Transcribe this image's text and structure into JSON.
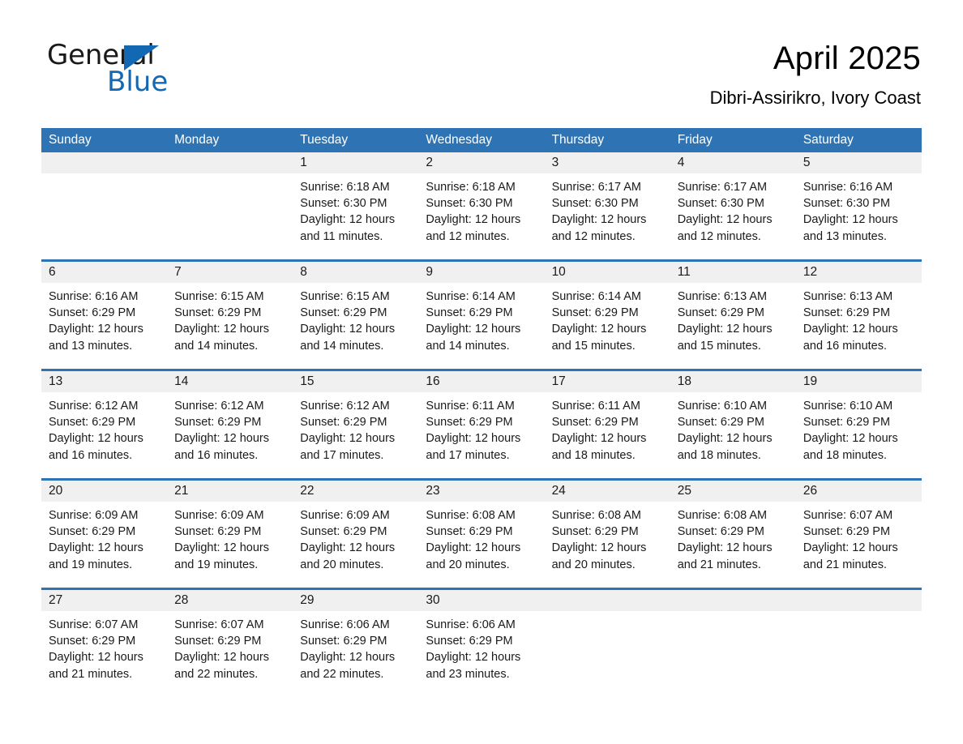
{
  "brand": {
    "word_one": "General",
    "word_two": "Blue",
    "triangle_icon": "blue-triangle-icon",
    "accent_color": "#1268b3"
  },
  "header": {
    "title": "April 2025",
    "location": "Dibri-Assirikro, Ivory Coast"
  },
  "calendar": {
    "header_color": "#2e74b5",
    "weekday_labels": [
      "Sunday",
      "Monday",
      "Tuesday",
      "Wednesday",
      "Thursday",
      "Friday",
      "Saturday"
    ],
    "weeks": [
      [
        {
          "day": "",
          "lines": []
        },
        {
          "day": "",
          "lines": []
        },
        {
          "day": "1",
          "lines": [
            "Sunrise: 6:18 AM",
            "Sunset: 6:30 PM",
            "Daylight: 12 hours",
            "and 11 minutes."
          ]
        },
        {
          "day": "2",
          "lines": [
            "Sunrise: 6:18 AM",
            "Sunset: 6:30 PM",
            "Daylight: 12 hours",
            "and 12 minutes."
          ]
        },
        {
          "day": "3",
          "lines": [
            "Sunrise: 6:17 AM",
            "Sunset: 6:30 PM",
            "Daylight: 12 hours",
            "and 12 minutes."
          ]
        },
        {
          "day": "4",
          "lines": [
            "Sunrise: 6:17 AM",
            "Sunset: 6:30 PM",
            "Daylight: 12 hours",
            "and 12 minutes."
          ]
        },
        {
          "day": "5",
          "lines": [
            "Sunrise: 6:16 AM",
            "Sunset: 6:30 PM",
            "Daylight: 12 hours",
            "and 13 minutes."
          ]
        }
      ],
      [
        {
          "day": "6",
          "lines": [
            "Sunrise: 6:16 AM",
            "Sunset: 6:29 PM",
            "Daylight: 12 hours",
            "and 13 minutes."
          ]
        },
        {
          "day": "7",
          "lines": [
            "Sunrise: 6:15 AM",
            "Sunset: 6:29 PM",
            "Daylight: 12 hours",
            "and 14 minutes."
          ]
        },
        {
          "day": "8",
          "lines": [
            "Sunrise: 6:15 AM",
            "Sunset: 6:29 PM",
            "Daylight: 12 hours",
            "and 14 minutes."
          ]
        },
        {
          "day": "9",
          "lines": [
            "Sunrise: 6:14 AM",
            "Sunset: 6:29 PM",
            "Daylight: 12 hours",
            "and 14 minutes."
          ]
        },
        {
          "day": "10",
          "lines": [
            "Sunrise: 6:14 AM",
            "Sunset: 6:29 PM",
            "Daylight: 12 hours",
            "and 15 minutes."
          ]
        },
        {
          "day": "11",
          "lines": [
            "Sunrise: 6:13 AM",
            "Sunset: 6:29 PM",
            "Daylight: 12 hours",
            "and 15 minutes."
          ]
        },
        {
          "day": "12",
          "lines": [
            "Sunrise: 6:13 AM",
            "Sunset: 6:29 PM",
            "Daylight: 12 hours",
            "and 16 minutes."
          ]
        }
      ],
      [
        {
          "day": "13",
          "lines": [
            "Sunrise: 6:12 AM",
            "Sunset: 6:29 PM",
            "Daylight: 12 hours",
            "and 16 minutes."
          ]
        },
        {
          "day": "14",
          "lines": [
            "Sunrise: 6:12 AM",
            "Sunset: 6:29 PM",
            "Daylight: 12 hours",
            "and 16 minutes."
          ]
        },
        {
          "day": "15",
          "lines": [
            "Sunrise: 6:12 AM",
            "Sunset: 6:29 PM",
            "Daylight: 12 hours",
            "and 17 minutes."
          ]
        },
        {
          "day": "16",
          "lines": [
            "Sunrise: 6:11 AM",
            "Sunset: 6:29 PM",
            "Daylight: 12 hours",
            "and 17 minutes."
          ]
        },
        {
          "day": "17",
          "lines": [
            "Sunrise: 6:11 AM",
            "Sunset: 6:29 PM",
            "Daylight: 12 hours",
            "and 18 minutes."
          ]
        },
        {
          "day": "18",
          "lines": [
            "Sunrise: 6:10 AM",
            "Sunset: 6:29 PM",
            "Daylight: 12 hours",
            "and 18 minutes."
          ]
        },
        {
          "day": "19",
          "lines": [
            "Sunrise: 6:10 AM",
            "Sunset: 6:29 PM",
            "Daylight: 12 hours",
            "and 18 minutes."
          ]
        }
      ],
      [
        {
          "day": "20",
          "lines": [
            "Sunrise: 6:09 AM",
            "Sunset: 6:29 PM",
            "Daylight: 12 hours",
            "and 19 minutes."
          ]
        },
        {
          "day": "21",
          "lines": [
            "Sunrise: 6:09 AM",
            "Sunset: 6:29 PM",
            "Daylight: 12 hours",
            "and 19 minutes."
          ]
        },
        {
          "day": "22",
          "lines": [
            "Sunrise: 6:09 AM",
            "Sunset: 6:29 PM",
            "Daylight: 12 hours",
            "and 20 minutes."
          ]
        },
        {
          "day": "23",
          "lines": [
            "Sunrise: 6:08 AM",
            "Sunset: 6:29 PM",
            "Daylight: 12 hours",
            "and 20 minutes."
          ]
        },
        {
          "day": "24",
          "lines": [
            "Sunrise: 6:08 AM",
            "Sunset: 6:29 PM",
            "Daylight: 12 hours",
            "and 20 minutes."
          ]
        },
        {
          "day": "25",
          "lines": [
            "Sunrise: 6:08 AM",
            "Sunset: 6:29 PM",
            "Daylight: 12 hours",
            "and 21 minutes."
          ]
        },
        {
          "day": "26",
          "lines": [
            "Sunrise: 6:07 AM",
            "Sunset: 6:29 PM",
            "Daylight: 12 hours",
            "and 21 minutes."
          ]
        }
      ],
      [
        {
          "day": "27",
          "lines": [
            "Sunrise: 6:07 AM",
            "Sunset: 6:29 PM",
            "Daylight: 12 hours",
            "and 21 minutes."
          ]
        },
        {
          "day": "28",
          "lines": [
            "Sunrise: 6:07 AM",
            "Sunset: 6:29 PM",
            "Daylight: 12 hours",
            "and 22 minutes."
          ]
        },
        {
          "day": "29",
          "lines": [
            "Sunrise: 6:06 AM",
            "Sunset: 6:29 PM",
            "Daylight: 12 hours",
            "and 22 minutes."
          ]
        },
        {
          "day": "30",
          "lines": [
            "Sunrise: 6:06 AM",
            "Sunset: 6:29 PM",
            "Daylight: 12 hours",
            "and 23 minutes."
          ]
        },
        {
          "day": "",
          "lines": []
        },
        {
          "day": "",
          "lines": []
        },
        {
          "day": "",
          "lines": []
        }
      ]
    ]
  }
}
